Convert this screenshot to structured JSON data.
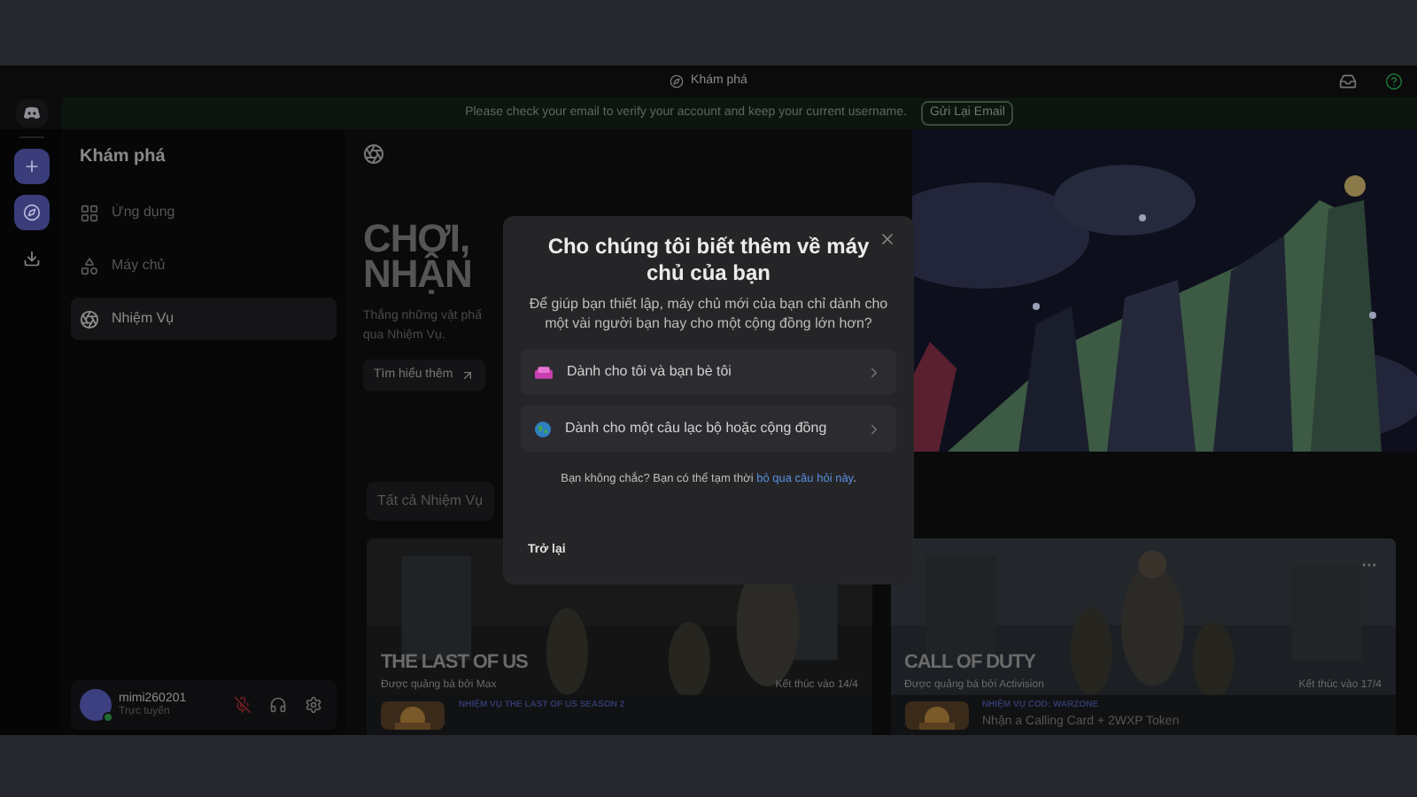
{
  "title_bar": {
    "title": "Khám phá"
  },
  "banner": {
    "text": "Please check your email to verify your account and keep your current username.",
    "button": "Gửi Lại Email"
  },
  "sidebar": {
    "title": "Khám phá",
    "items": [
      {
        "label": "Ứng dụng",
        "kind": "apps",
        "selected": false
      },
      {
        "label": "Máy chủ",
        "kind": "servers",
        "selected": false
      },
      {
        "label": "Nhiệm Vụ",
        "kind": "quests",
        "selected": true
      }
    ]
  },
  "user": {
    "name": "mimi260201",
    "status": "Trực tuyến",
    "mic_muted": true
  },
  "hero": {
    "heading": [
      "CHƠI,",
      "NHẬN"
    ],
    "subtitle": [
      "Thắng những vật phẩ",
      "qua Nhiệm Vụ."
    ],
    "button": "Tìm hiểu thêm"
  },
  "filter_tab": {
    "label": "Tất cả Nhiệm Vụ"
  },
  "cards": [
    {
      "logo": "THE LAST OF US",
      "promoted": "Được quảng bá bởi Max",
      "ends": "Kết thúc vào 14/4",
      "quest": "NHIỆM VỤ THE LAST OF US SEASON 2"
    },
    {
      "logo": "CALL OF DUTY",
      "promoted": "Được quảng bá bởi Activision",
      "ends": "Kết thúc vào 17/4",
      "quest": "NHIỆM VỤ COD: WARZONE",
      "reward": "Nhận a Calling Card + 2WXP Token"
    }
  ],
  "modal": {
    "title": "Cho chúng tôi biết thêm về máy chủ của bạn",
    "description": "Để giúp bạn thiết lập, máy chủ mới của bạn chỉ dành cho một vài người bạn hay cho một cộng đồng lớn hơn?",
    "options": [
      {
        "label": "Dành cho tôi và bạn bè tôi",
        "kind": "friends"
      },
      {
        "label": "Dành cho một câu lạc bộ hoặc cộng đồng",
        "kind": "community"
      }
    ],
    "note": "Bạn không chắc? Bạn có thể tạm thời",
    "note_link": "bỏ qua câu hỏi này",
    "note_end": ".",
    "back": "Trở lại"
  }
}
